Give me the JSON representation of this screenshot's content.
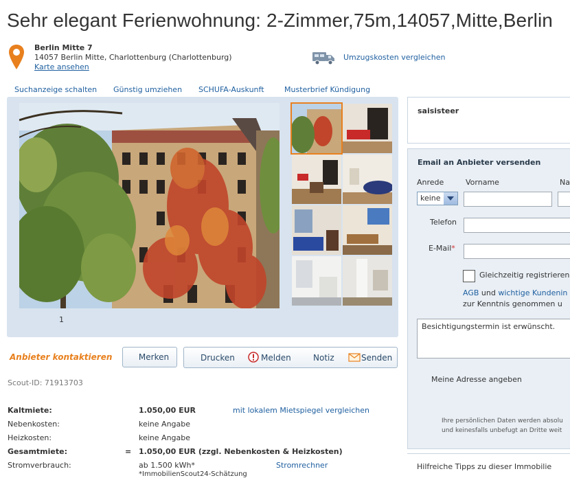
{
  "title": "Sehr elegant Ferienwohnung: 2-Zimmer,75m,14057,Mitte,Berlin",
  "address": {
    "name": "Berlin Mitte 7",
    "line": "14057 Berlin Mitte, Charlottenburg (Charlottenburg)",
    "map_link": "Karte ansehen",
    "moving_link": "Umzugskosten vergleichen",
    "icons": [
      "map-pin-icon",
      "moving-truck-icon"
    ],
    "pin_color": "#e8801e"
  },
  "top_links": [
    "Suchanzeige schalten",
    "Günstig umziehen",
    "SCHUFA-Auskunft",
    "Musterbrief Kündigung"
  ],
  "gallery": {
    "counter": "1",
    "selected_color": "#e8801e"
  },
  "actions": {
    "contact": "Anbieter kontaktieren",
    "merken": "Merken",
    "drucken": "Drucken",
    "melden": "Melden",
    "notiz": "Notiz",
    "senden": "Senden"
  },
  "scout_id": "Scout-ID: 71913703",
  "costs": [
    {
      "label": "Kaltmiete:",
      "bold": true,
      "eq": "",
      "value": "1.050,00 EUR",
      "link": "mit lokalem Mietspiegel vergleichen"
    },
    {
      "label": "Nebenkosten:",
      "bold": false,
      "eq": "",
      "value": "keine Angabe",
      "link": ""
    },
    {
      "label": "Heizkosten:",
      "bold": false,
      "eq": "",
      "value": "keine Angabe",
      "link": ""
    },
    {
      "label": "Gesamtmiete:",
      "bold": true,
      "eq": "=",
      "value": "1.050,00 EUR (zzgl. Nebenkosten & Heizkosten)",
      "link": ""
    },
    {
      "label": "Stromverbrauch:",
      "bold": false,
      "eq": "",
      "value": "ab 1.500 kWh*",
      "link": "Stromrechner"
    }
  ],
  "cost_note": "*ImmobilienScout24-Schätzung",
  "sidebar": {
    "provider": "saisisteer",
    "email_heading": "Email an Anbieter versenden",
    "anrede_label": "Anrede",
    "anrede_value": "keine",
    "vorname_label": "Vorname",
    "nachname_label": "Na",
    "telefon_label": "Telefon",
    "email_label": "E-Mail",
    "register_label": "Gleichzeitig registrieren",
    "agb_1": "AGB",
    "agb_2": " und ",
    "agb_3": "wichtige Kundenin",
    "agb_4": "zur Kenntnis genommen u",
    "message": "Besichtigungstermin ist erwünscht.",
    "address_link": "Meine Adresse angeben",
    "privacy_1": "Ihre persönlichen Daten werden absolu",
    "privacy_2": "und keinesfalls unbefugt an Dritte weit",
    "tips": "Hilfreiche Tipps zu dieser Immobilie"
  }
}
